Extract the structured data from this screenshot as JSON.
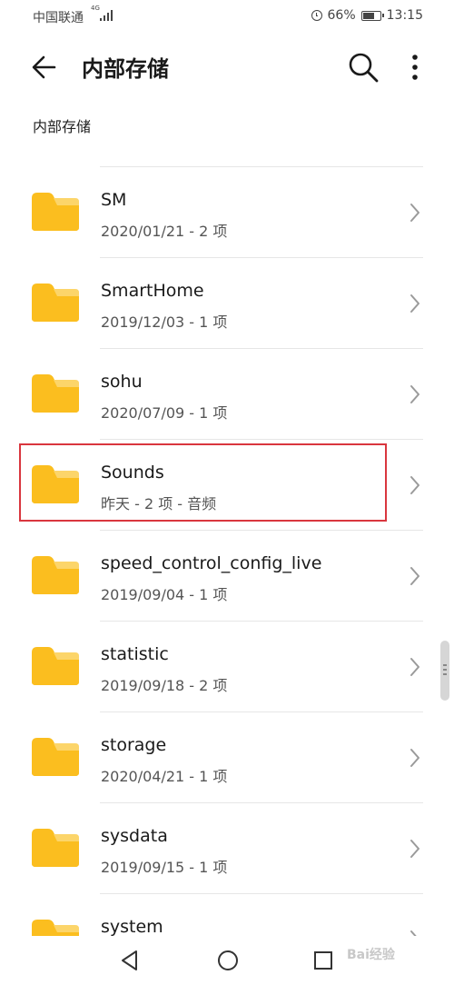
{
  "status_bar": {
    "carrier": "中国联通",
    "network": "4G",
    "battery": "66%",
    "time": "13:15"
  },
  "header": {
    "title": "内部存储"
  },
  "breadcrumb": "内部存储",
  "files": [
    {
      "name": "SM",
      "meta": "2020/01/21 - 2 项"
    },
    {
      "name": "SmartHome",
      "meta": "2019/12/03 - 1 项"
    },
    {
      "name": "sohu",
      "meta": "2020/07/09 - 1 项"
    },
    {
      "name": "Sounds",
      "meta": "昨天 - 2 项 - 音频"
    },
    {
      "name": "speed_control_config_live",
      "meta": "2019/09/04 - 1 项"
    },
    {
      "name": "statistic",
      "meta": "2019/09/18 - 2 项"
    },
    {
      "name": "storage",
      "meta": "2020/04/21 - 1 项"
    },
    {
      "name": "sysdata",
      "meta": "2019/09/15 - 1 项"
    },
    {
      "name": "system",
      "meta": ""
    }
  ],
  "watermark": "Bai经验",
  "colors": {
    "folder": "#fbbe1f",
    "folder_tab": "#fcd56a",
    "highlight": "#d9363e"
  }
}
